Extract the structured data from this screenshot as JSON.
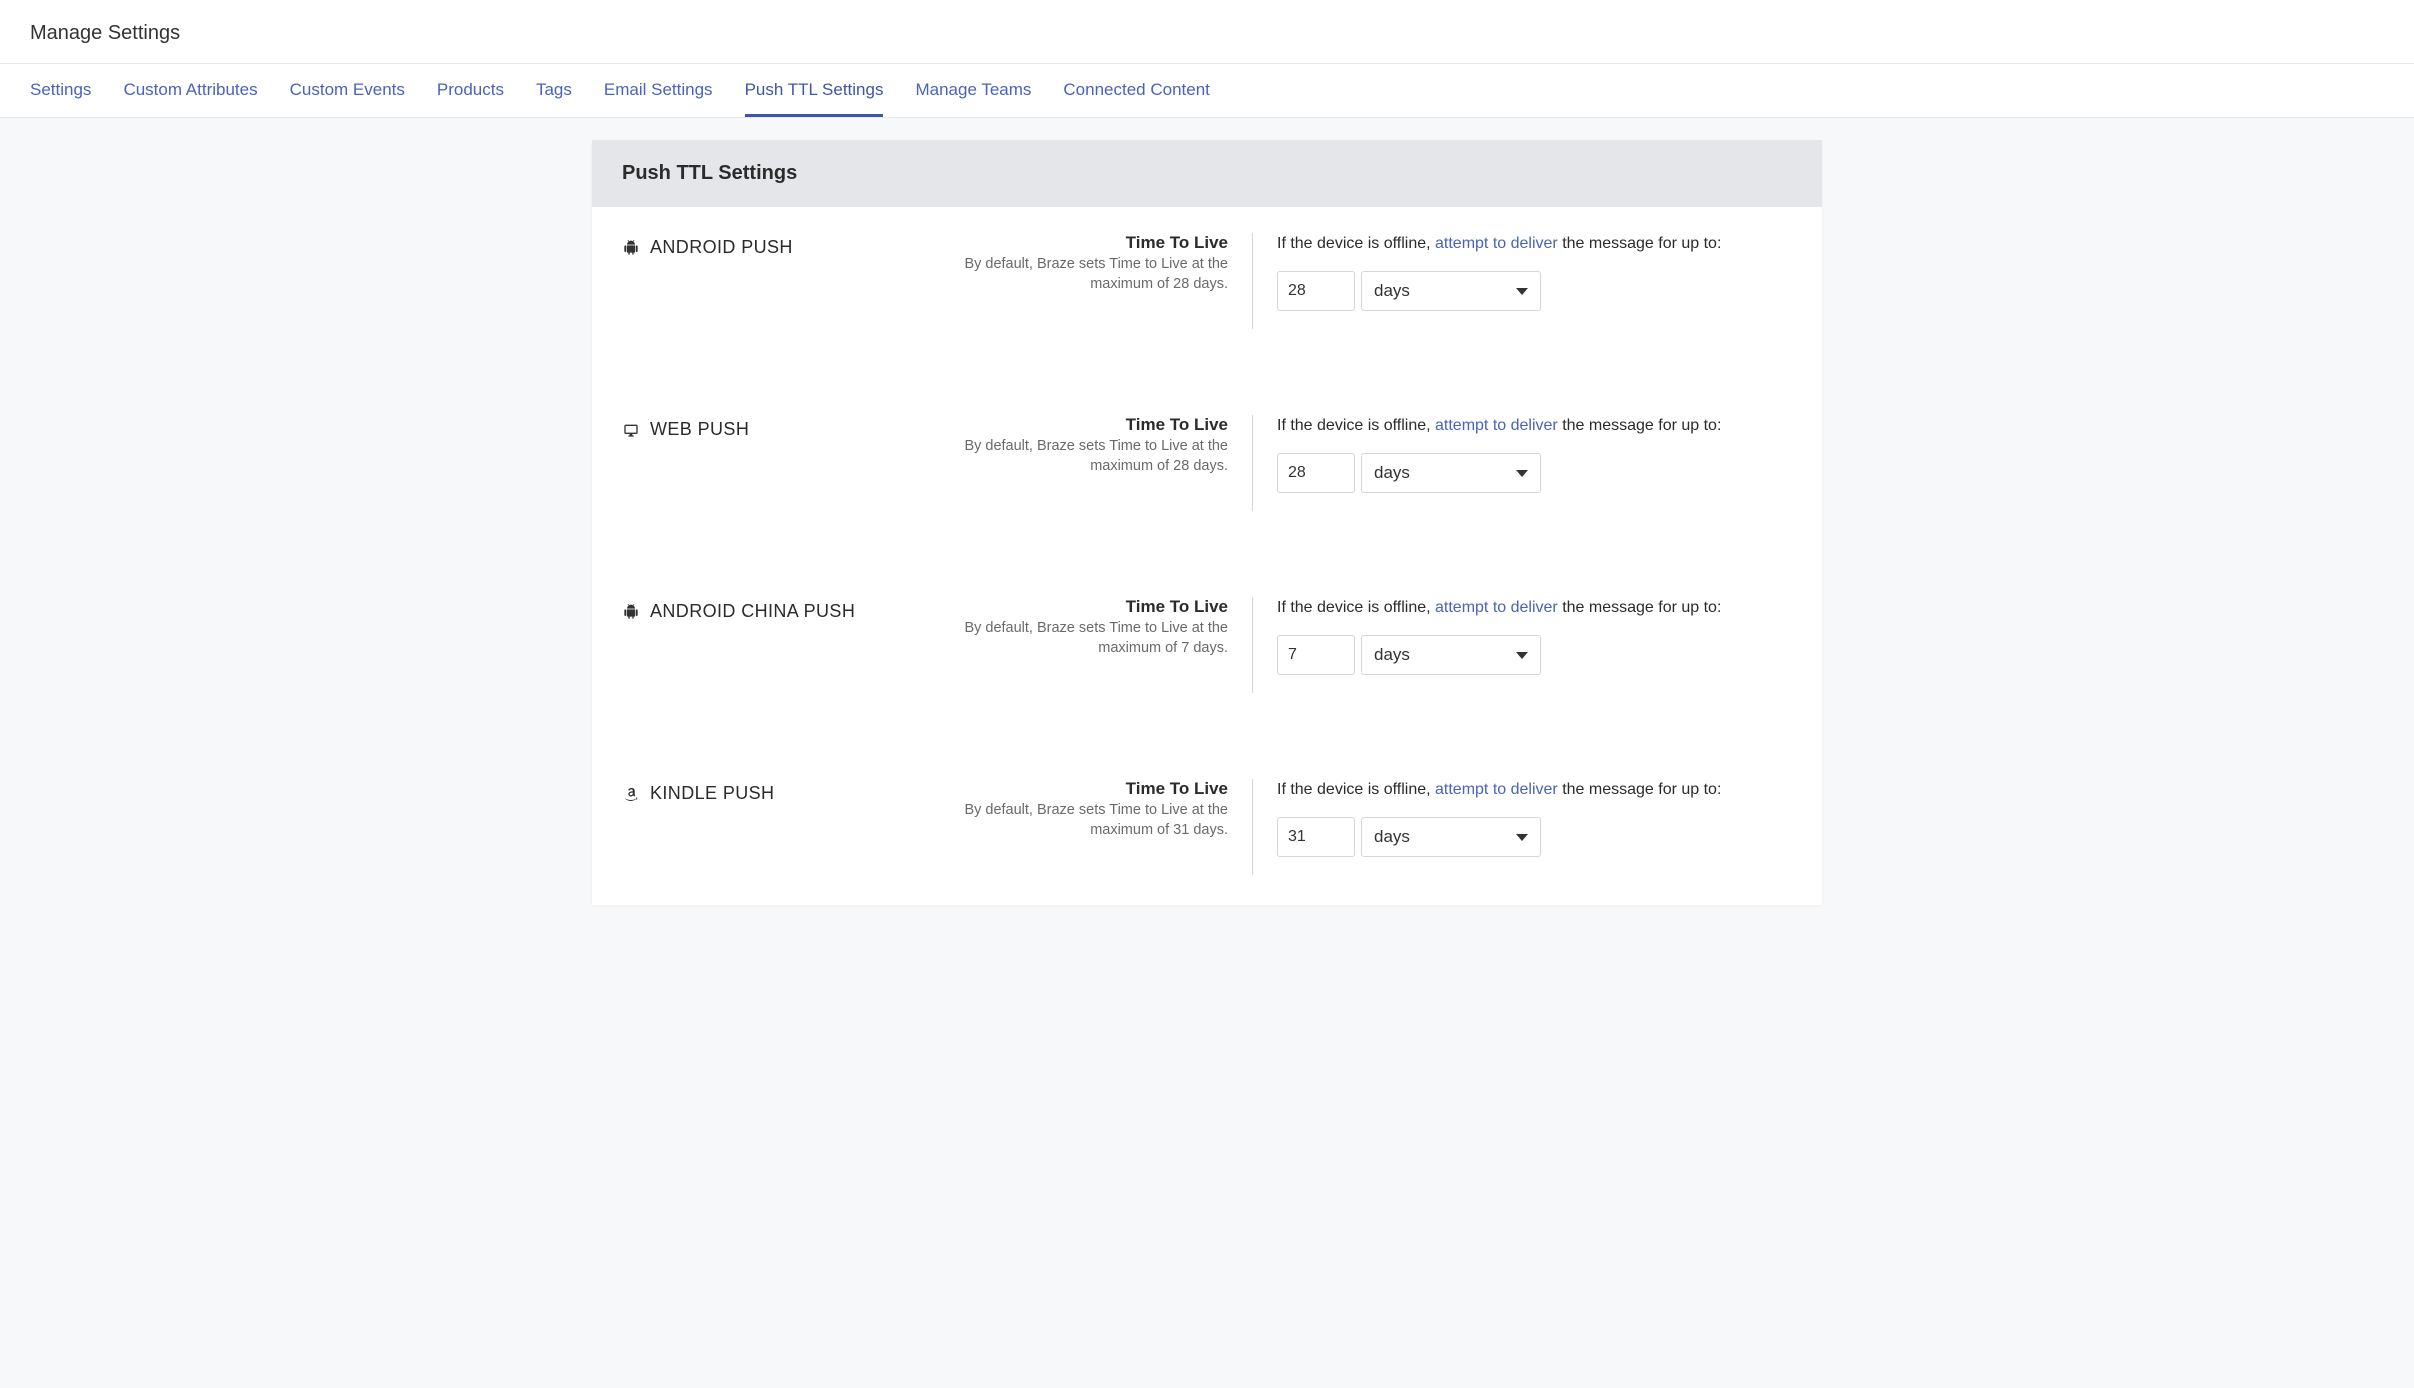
{
  "page": {
    "title": "Manage Settings"
  },
  "tabs": [
    {
      "label": "Settings",
      "active": false
    },
    {
      "label": "Custom Attributes",
      "active": false
    },
    {
      "label": "Custom Events",
      "active": false
    },
    {
      "label": "Products",
      "active": false
    },
    {
      "label": "Tags",
      "active": false
    },
    {
      "label": "Email Settings",
      "active": false
    },
    {
      "label": "Push TTL Settings",
      "active": true
    },
    {
      "label": "Manage Teams",
      "active": false
    },
    {
      "label": "Connected Content",
      "active": false
    }
  ],
  "panel": {
    "title": "Push TTL Settings",
    "ttl_heading": "Time To Live",
    "offline_prefix": "If the device is offline, ",
    "offline_link": "attempt to deliver",
    "offline_suffix": " the message for up to:"
  },
  "platforms": [
    {
      "icon": "android-icon",
      "name": "ANDROID PUSH",
      "default_text": "By default, Braze sets Time to Live at the maximum of 28 days.",
      "value": "28",
      "unit": "days"
    },
    {
      "icon": "web-icon",
      "name": "WEB PUSH",
      "default_text": "By default, Braze sets Time to Live at the maximum of 28 days.",
      "value": "28",
      "unit": "days"
    },
    {
      "icon": "android-icon",
      "name": "ANDROID CHINA PUSH",
      "default_text": "By default, Braze sets Time to Live at the maximum of 7 days.",
      "value": "7",
      "unit": "days"
    },
    {
      "icon": "amazon-icon",
      "name": "KINDLE PUSH",
      "default_text": "By default, Braze sets Time to Live at the maximum of 31 days.",
      "value": "31",
      "unit": "days"
    }
  ]
}
